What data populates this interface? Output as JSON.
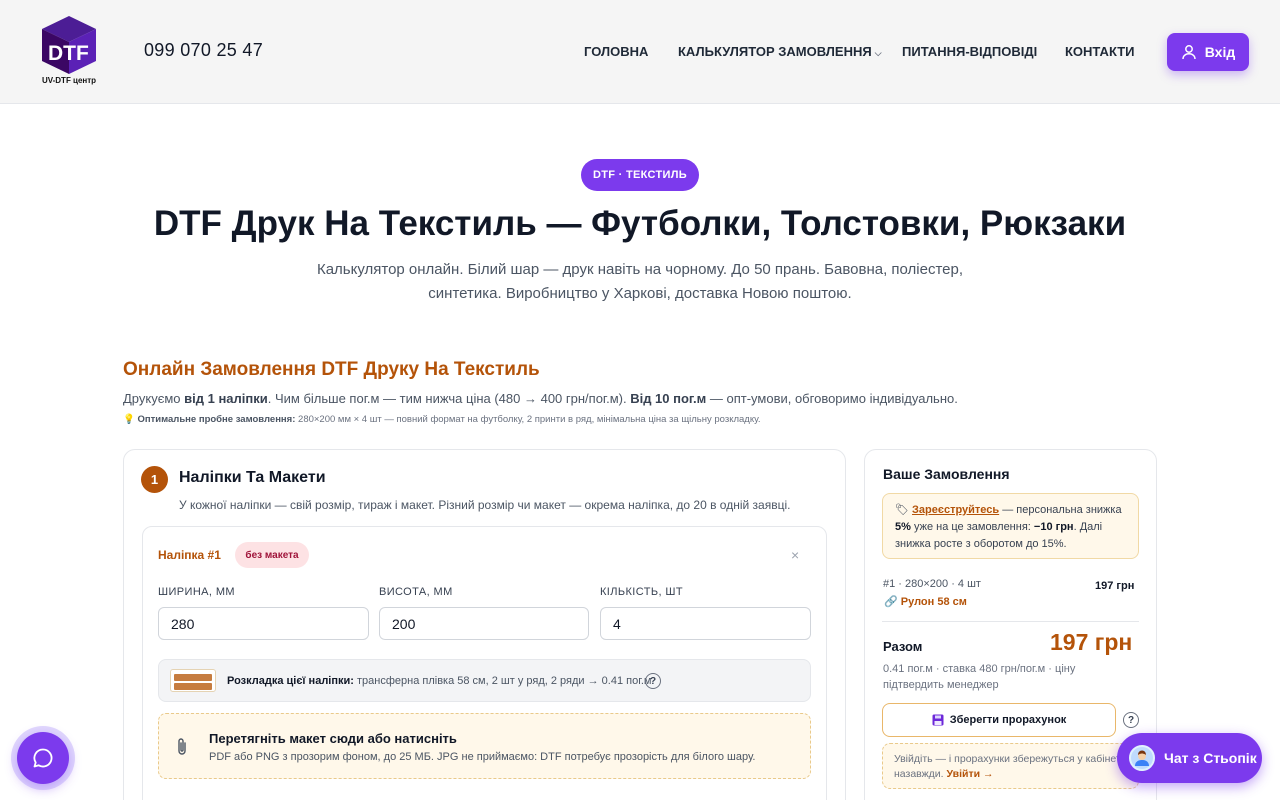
{
  "header": {
    "logo_text": "DTF",
    "logo_caption": "UV-DTF центр",
    "phone": "099 070 25 47",
    "nav": [
      {
        "label": "ГОЛОВНА"
      },
      {
        "label": "КАЛЬКУЛЯТОР ЗАМОВЛЕННЯ",
        "has_dropdown": true
      },
      {
        "label": "ПИТАННЯ-ВІДПОВІДІ"
      },
      {
        "label": "КОНТАКТИ"
      }
    ],
    "login_label": "Вхід"
  },
  "hero": {
    "badge": "DTF · ТЕКСТИЛЬ",
    "title": "DTF Друк На Текстиль — Футболки, Толстовки, Рюкзаки",
    "subtitle": "Калькулятор онлайн. Білий шар — друк навіть на чорному. До 50 прань. Бавовна, поліестер, синтетика. Виробництво у Харкові, доставка Новою поштою."
  },
  "section": {
    "title": "Онлайн Замовлення DTF Друку На Текстиль",
    "desc_1": "Друкуємо ",
    "desc_b1": "від 1 наліпки",
    "desc_2": ". Чим більше пог.м — тим нижча ціна (480 → 400 грн/пог.м). ",
    "desc_b2": "Від 10 пог.м",
    "desc_3": " — опт-умови, обговоримо індивідуально.",
    "hint_icon": "💡",
    "hint_b": "Оптимальне пробне замовлення:",
    "hint_text": " 280×200 мм × 4 шт — повний формат на футболку, 2 принти в ряд, мінімальна ціна за щільну розкладку."
  },
  "step1": {
    "number": "1",
    "title": "Наліпки Та Макети",
    "desc": "У кожної наліпки — свій розмір, тираж і макет. Різний розмір чи макет — окрема наліпка, до 20 в одній заявці.",
    "sticker": {
      "title": "Наліпка #1",
      "badge": "без макета",
      "close": "×",
      "width_label": "ШИРИНА, ММ",
      "width_value": "280",
      "height_label": "ВИСОТА, ММ",
      "height_value": "200",
      "qty_label": "КІЛЬКІСТЬ, ШТ",
      "qty_value": "4",
      "layout_b": "Розкладка цієї наліпки:",
      "layout_text": " трансферна плівка 58 см, 2 шт у ряд, 2 ряди → 0.41 пог.м",
      "help": "?",
      "drop_title": "Перетягніть макет сюди або натисніть",
      "drop_desc": "PDF або PNG з прозорим фоном, до 25 МБ. JPG не приймаємо: DTF потребує прозорість для білого шару."
    }
  },
  "order": {
    "title": "Ваше Замовлення",
    "promo_icon": "🏷",
    "promo_link": "Зареєструйтесь",
    "promo_1": " — персональна знижка ",
    "promo_b1": "5%",
    "promo_2": " уже на це замовлення: ",
    "promo_b2": "−10 грн",
    "promo_3": ". Далі знижка росте з оборотом до 15%.",
    "line": "#1 · 280×200 · 4 шт",
    "line_price": "197 грн",
    "roll": "Рулон 58 см",
    "total_label": "Разом",
    "total_value": "197 грн",
    "total_note": "0.41 пог.м · ставка 480 грн/пог.м · ціну підтвердить менеджер",
    "save_label": "Зберегти прорахунок",
    "help": "?",
    "login_note_1": "Увійдіть — і прорахунки збережуться у кабінеті",
    "login_note_2": "назавжди. ",
    "login_link": "Увійти →"
  },
  "chat": {
    "label": "Чат з Стьопік"
  },
  "colors": {
    "accent": "#7c3aed",
    "brand_orange": "#b45309"
  }
}
